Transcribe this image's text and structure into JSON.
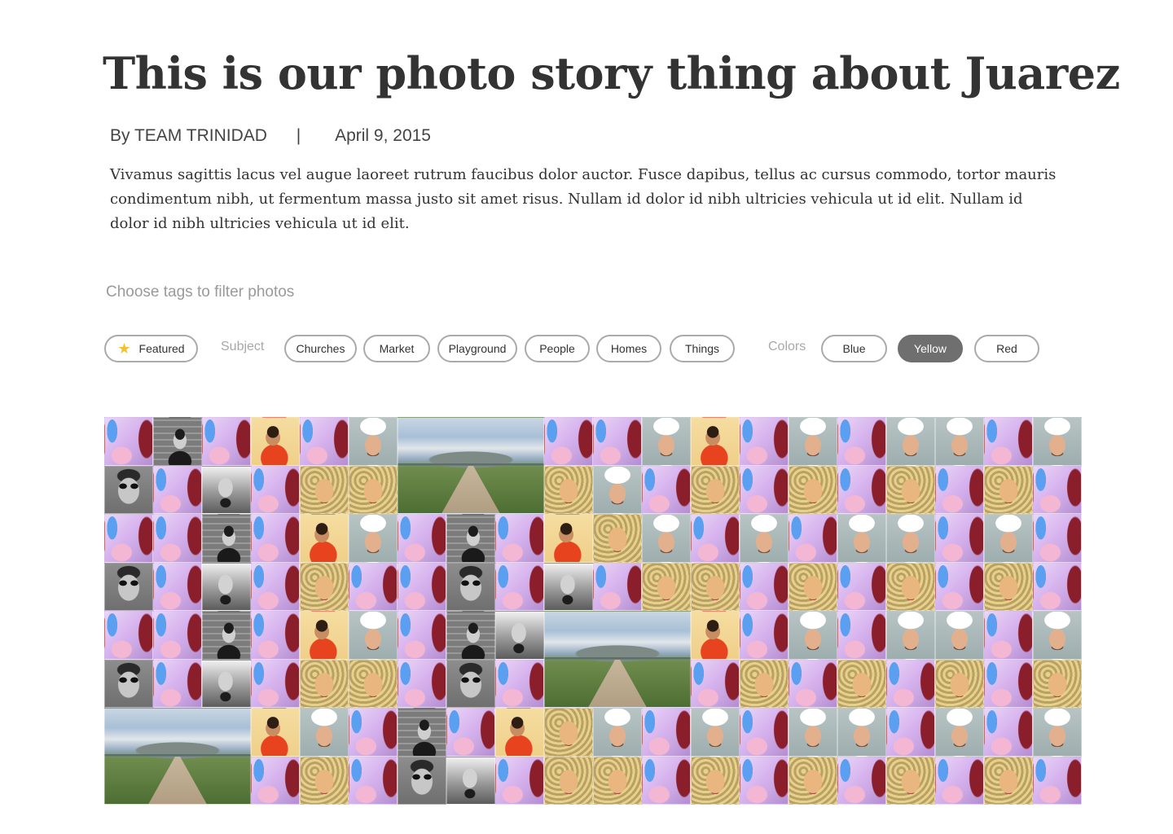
{
  "article": {
    "title": "This is our photo story thing about Juarez",
    "byline": "By TEAM TRINIDAD",
    "separator": "|",
    "date": "April 9, 2015",
    "intro": "Vivamus sagittis lacus vel augue laoreet rutrum faucibus dolor auctor. Fusce dapibus, tellus ac cursus commodo, tortor mauris condimentum nibh, ut fermentum massa justo sit amet risus. Nullam id dolor id nibh ultricies vehicula ut id elit. Nullam id dolor id nibh ultricies vehicula ut id elit."
  },
  "filters": {
    "hint": "Choose tags to filter photos",
    "featured": {
      "label": "Featured",
      "icon": "star-icon",
      "icon_color": "#f3c12d"
    },
    "subject_label": "Subject",
    "subject_tags": [
      "Churches",
      "Market",
      "Playground",
      "People",
      "Homes",
      "Things"
    ],
    "colors_label": "Colors",
    "color_tags": [
      "Blue",
      "Yellow",
      "Red"
    ],
    "selected": "Yellow",
    "active_color": "#6f6f6f"
  },
  "mosaic": {
    "columns": 20,
    "rows": 8,
    "rows_grid": [
      "pbpypcKKyppcypcpccpc",
      "gpfpaoKKpacpapapapap",
      "ppbpycpbpyacpcpccpcp",
      "gpfpappgpfpaapapapap",
      "ppbpycpbfKKKypcpccpc",
      "gpfpaopgpKKKpapapapa",
      "KKKycpbpyacpcpccpcpc",
      "KKKpapgfpaapapapapap"
    ],
    "large_tiles": [
      {
        "row": 0,
        "col": 6,
        "span": 3,
        "photo": "castle"
      },
      {
        "row": 4,
        "col": 9,
        "span": 3,
        "photo": "castle"
      },
      {
        "row": 6,
        "col": 0,
        "span": 3,
        "photo": "castle"
      }
    ]
  }
}
